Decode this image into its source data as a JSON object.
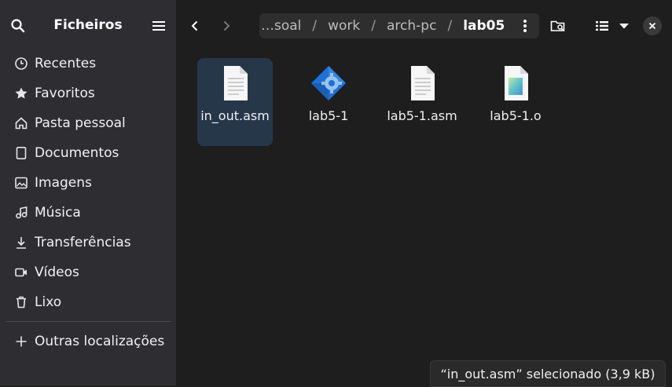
{
  "sidebar": {
    "title": "Ficheiros",
    "items": [
      {
        "label": "Recentes",
        "icon": "clock-icon"
      },
      {
        "label": "Favoritos",
        "icon": "star-icon"
      },
      {
        "label": "Pasta pessoal",
        "icon": "home-icon"
      },
      {
        "label": "Documentos",
        "icon": "document-icon"
      },
      {
        "label": "Imagens",
        "icon": "image-icon"
      },
      {
        "label": "Música",
        "icon": "music-icon"
      },
      {
        "label": "Transferências",
        "icon": "download-icon"
      },
      {
        "label": "Vídeos",
        "icon": "video-icon"
      },
      {
        "label": "Lixo",
        "icon": "trash-icon"
      }
    ],
    "other": {
      "label": "Outras localizações",
      "icon": "plus-icon"
    }
  },
  "path": {
    "crumbs": [
      "…soal",
      "work",
      "arch-pc",
      "lab05"
    ]
  },
  "files": [
    {
      "name": "in_out.asm",
      "icon": "text-file-icon",
      "selected": true
    },
    {
      "name": "lab5-1",
      "icon": "executable-icon",
      "selected": false
    },
    {
      "name": "lab5-1.asm",
      "icon": "text-file-icon",
      "selected": false
    },
    {
      "name": "lab5-1.o",
      "icon": "object-file-icon",
      "selected": false
    }
  ],
  "status": "“in_out.asm” selecionado (3,9 kB)",
  "colors": {
    "accent": "#3584e4",
    "selection": "#27374a",
    "sidebar": "#2e2e32"
  }
}
